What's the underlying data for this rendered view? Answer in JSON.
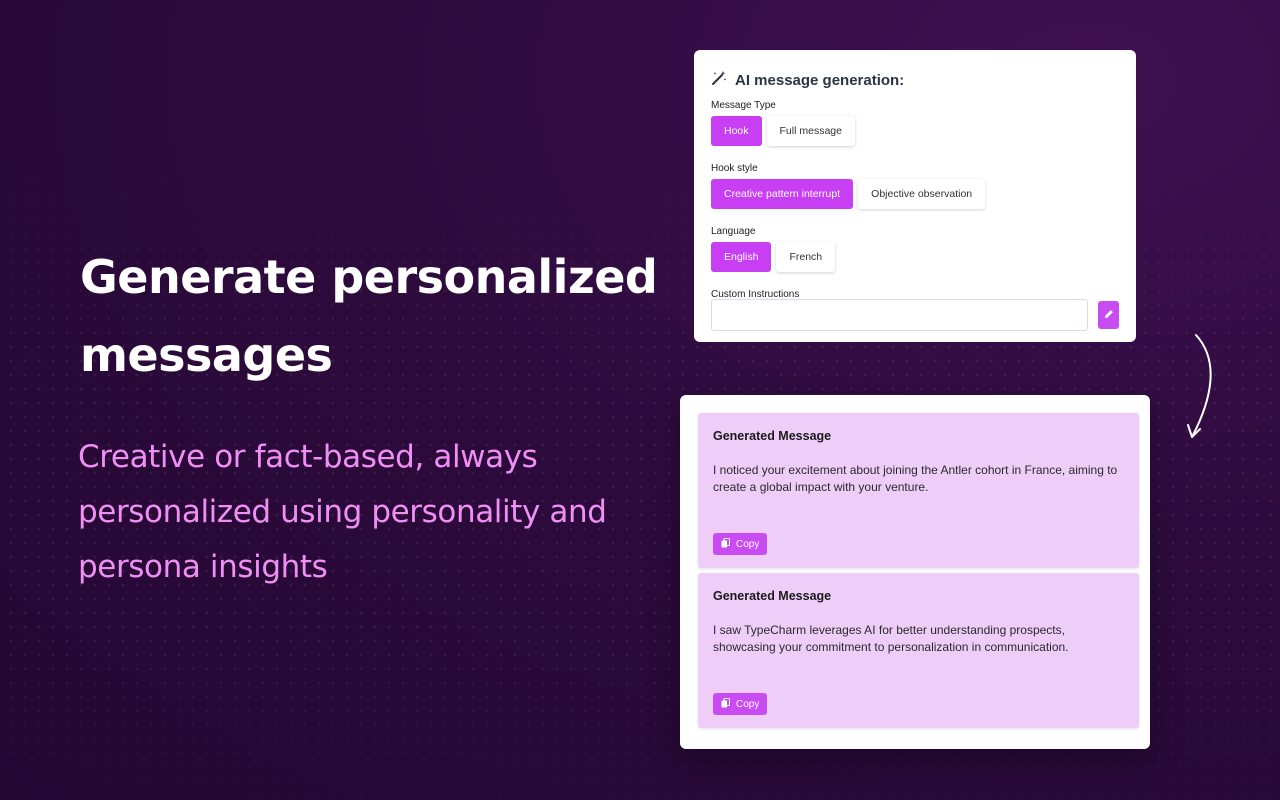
{
  "hero": {
    "title": "Generate personalized messages",
    "subtitle": "Creative or fact-based, always personalized using personality and persona insights"
  },
  "generator": {
    "title": "AI message generation:",
    "icon": "magic-wand-icon",
    "message_type": {
      "label": "Message Type",
      "options": [
        "Hook",
        "Full message"
      ],
      "selected": "Hook"
    },
    "hook_style": {
      "label": "Hook style",
      "options": [
        "Creative pattern interrupt",
        "Objective observation"
      ],
      "selected": "Creative pattern interrupt"
    },
    "language": {
      "label": "Language",
      "options": [
        "English",
        "French"
      ],
      "selected": "English"
    },
    "custom_instructions": {
      "label": "Custom Instructions",
      "value": "",
      "placeholder": ""
    },
    "edit_icon": "pencil-icon"
  },
  "results": {
    "messages": [
      {
        "title": "Generated Message",
        "text": "I noticed your excitement about joining the Antler cohort in France, aiming to create a global impact with your venture.",
        "copy_label": "Copy"
      },
      {
        "title": "Generated Message",
        "text": "I saw TypeCharm leverages AI for better understanding prospects, showcasing your commitment to personalization in communication.",
        "copy_label": "Copy"
      }
    ]
  },
  "colors": {
    "accent": "#c73ef3",
    "background": "#2e0b3d",
    "subtitle": "#f08ff3",
    "message_bg": "#eecdf9"
  }
}
